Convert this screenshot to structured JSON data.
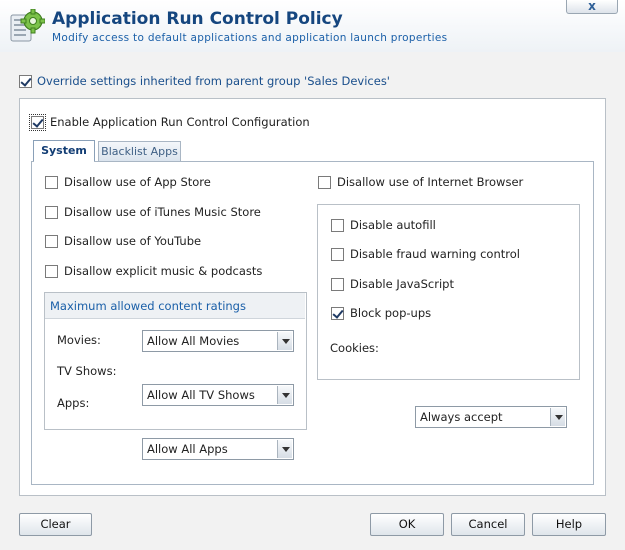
{
  "header": {
    "title": "Application Run Control Policy",
    "subtitle": "Modify access to default applications and application launch properties",
    "close_label": "x"
  },
  "override": {
    "label": "Override settings inherited from parent group 'Sales Devices'",
    "checked": true
  },
  "enable": {
    "label": "Enable Application Run Control Configuration",
    "checked": true
  },
  "tabs": [
    {
      "label": "System",
      "active": true
    },
    {
      "label": "Blacklist Apps",
      "active": false
    }
  ],
  "system": {
    "left_options": [
      {
        "label": "Disallow use of App Store",
        "checked": false
      },
      {
        "label": "Disallow use of iTunes Music Store",
        "checked": false
      },
      {
        "label": "Disallow use of YouTube",
        "checked": false
      },
      {
        "label": "Disallow explicit music & podcasts",
        "checked": false
      }
    ],
    "ratings": {
      "heading": "Maximum allowed content ratings",
      "rows": [
        {
          "label": "Movies:",
          "value": "Allow All Movies"
        },
        {
          "label": "TV Shows:",
          "value": "Allow All TV Shows"
        },
        {
          "label": "Apps:",
          "value": "Allow All Apps"
        }
      ]
    },
    "browser": {
      "label": "Disallow use of Internet Browser",
      "checked": false
    },
    "browser_options": [
      {
        "label": "Disable autofill",
        "checked": false
      },
      {
        "label": "Disable fraud warning control",
        "checked": false
      },
      {
        "label": "Disable JavaScript",
        "checked": false
      },
      {
        "label": "Block pop-ups",
        "checked": true
      }
    ],
    "cookies": {
      "label": "Cookies:",
      "value": "Always accept"
    }
  },
  "buttons": {
    "clear": "Clear",
    "ok": "OK",
    "cancel": "Cancel",
    "help": "Help"
  }
}
